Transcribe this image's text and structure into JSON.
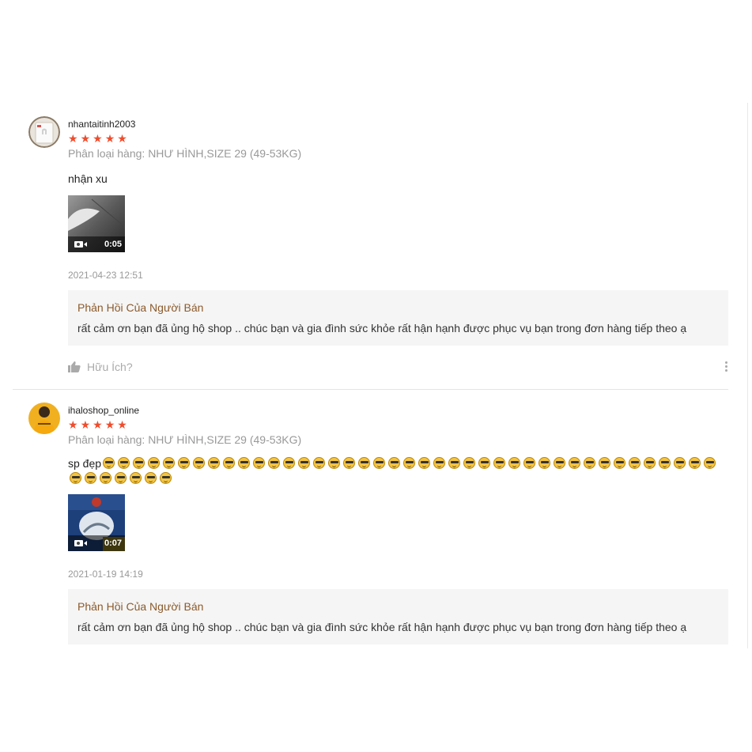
{
  "reviews": [
    {
      "username": "nhantaitinh2003",
      "rating": 5,
      "variation": "Phân loại hàng: NHƯ HÌNH,SIZE 29 (49-53KG)",
      "comment": "nhận xu",
      "video_duration": "0:05",
      "datetime": "2021-04-23 12:51",
      "seller_reply_title": "Phản Hồi Của Người Bán",
      "seller_reply": "rất cảm ơn bạn đã ủng hộ shop .. chúc bạn và gia đình sức khỏe rất hận hạnh được phục vụ bạn trong đơn hàng tiếp theo ạ",
      "helpful_label": "Hữu Ích?"
    },
    {
      "username": "ihaloshop_online",
      "rating": 5,
      "variation": "Phân loại hàng: NHƯ HÌNH,SIZE 29 (49-53KG)",
      "comment": "sp đẹp",
      "emoji_name": "sunglasses-emoji",
      "emoji_count": 48,
      "video_duration": "0:07",
      "datetime": "2021-01-19 14:19",
      "seller_reply_title": "Phản Hồi Của Người Bán",
      "seller_reply": "rất cảm ơn bạn đã ủng hộ shop .. chúc bạn và gia đình sức khỏe rất hận hạnh được phục vụ bạn trong đơn hàng tiếp theo ạ"
    }
  ],
  "colors": {
    "star": "#ee4d2d",
    "reply_title": "#8b5a2b",
    "muted": "#999999"
  }
}
